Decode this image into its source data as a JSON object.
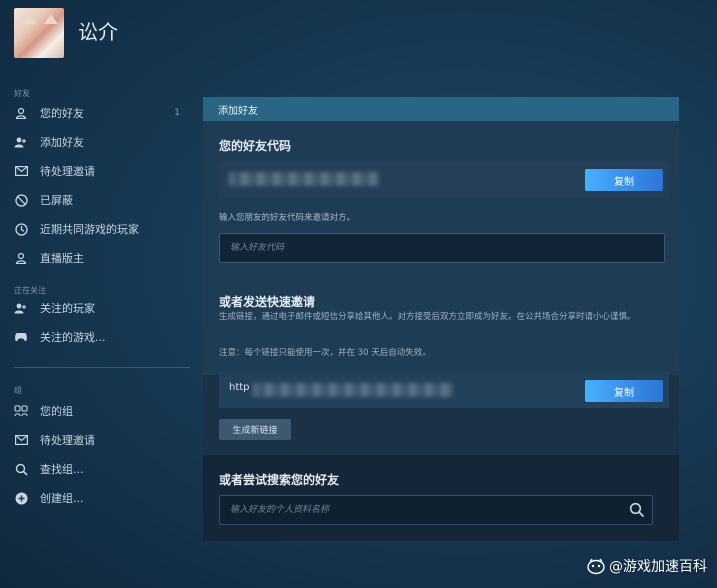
{
  "profile": {
    "username": "讼介"
  },
  "sidebar": {
    "friends_section": "好友",
    "friends_items": [
      {
        "label": "您的好友",
        "icon": "person-icon",
        "count": "1"
      },
      {
        "label": "添加好友",
        "icon": "add-person-icon"
      },
      {
        "label": "待处理邀请",
        "icon": "mail-icon"
      },
      {
        "label": "已屏蔽",
        "icon": "blocked-icon"
      },
      {
        "label": "近期共同游戏的玩家",
        "icon": "clock-icon"
      },
      {
        "label": "直播版主",
        "icon": "person-icon"
      }
    ],
    "following_section": "正在关注",
    "following_items": [
      {
        "label": "关注的玩家",
        "icon": "add-person-icon"
      },
      {
        "label": "关注的游戏...",
        "icon": "gamepad-icon"
      }
    ],
    "groups_section": "组",
    "group_items": [
      {
        "label": "您的组",
        "icon": "group-icon"
      },
      {
        "label": "待处理邀请",
        "icon": "mail-icon"
      },
      {
        "label": "查找组...",
        "icon": "search-icon"
      },
      {
        "label": "创建组...",
        "icon": "plus-circle-icon"
      }
    ]
  },
  "panel": {
    "header": "添加好友",
    "friend_code_title": "您的好友代码",
    "copy_label": "复制",
    "hint": "输入您朋友的好友代码来邀请对方。",
    "code_placeholder": "输入好友代码",
    "quick_invite_title": "或者发送快速邀请",
    "quick_invite_desc": "生成链接，通过电子邮件或短信分享给其他人。对方接受后双方立即成为好友。在公共场合分享时请小心谨慎。",
    "notice": "注意：每个链接只能使用一次，并在 30 天后自动失效。",
    "link_prefix": "http",
    "copy_label_2": "复制",
    "generate_label": "生成新链接",
    "search_title": "或者尝试搜索您的好友",
    "search_placeholder": "输入好友的个人资料名称"
  },
  "watermark": {
    "text": "@游戏加速百科"
  }
}
